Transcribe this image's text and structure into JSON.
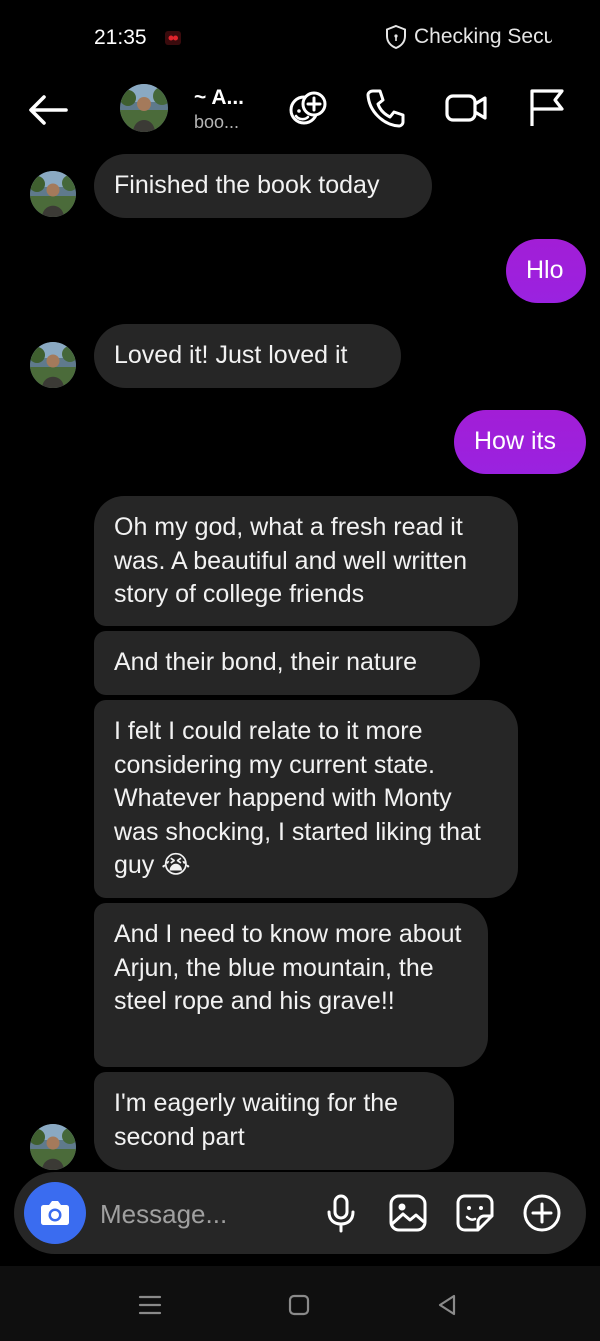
{
  "status_bar": {
    "time": "21:35",
    "security_text": "Checking Secu",
    "record_indicator_color": "#e0242c"
  },
  "header": {
    "contact_name": "~ A...",
    "contact_subtitle": "boo...",
    "icons": [
      "back-arrow-icon",
      "add-effect-icon",
      "phone-icon",
      "video-call-icon",
      "flag-icon"
    ]
  },
  "messages": [
    {
      "direction": "incoming",
      "text": "Finished the book today",
      "show_avatar": true
    },
    {
      "direction": "outgoing",
      "text": "Hlo"
    },
    {
      "direction": "incoming",
      "text": "Loved it! Just loved it",
      "show_avatar": true
    },
    {
      "direction": "outgoing",
      "text": "How its"
    },
    {
      "direction": "incoming",
      "text": "Oh my god, what a fresh read it was. A beautiful and well written story of college friends"
    },
    {
      "direction": "incoming",
      "text": "And their bond, their nature"
    },
    {
      "direction": "incoming",
      "text": "I felt I could relate to it more considering my current state. Whatever happend with Monty was shocking, I started liking that guy",
      "emoji": "😭"
    },
    {
      "direction": "incoming",
      "text": "And I need to know more about Arjun, the blue mountain, the steel rope and his grave!!"
    },
    {
      "direction": "incoming",
      "text": "I'm eagerly waiting for the second part",
      "show_avatar": true
    }
  ],
  "composer": {
    "placeholder": "Message...",
    "icons": [
      "camera-icon",
      "microphone-icon",
      "gallery-icon",
      "sticker-icon",
      "add-icon"
    ]
  },
  "colors": {
    "background": "#000000",
    "incoming_bubble": "#262626",
    "outgoing_bubble": "#a01ed8",
    "camera_button": "#3a6cf0"
  }
}
